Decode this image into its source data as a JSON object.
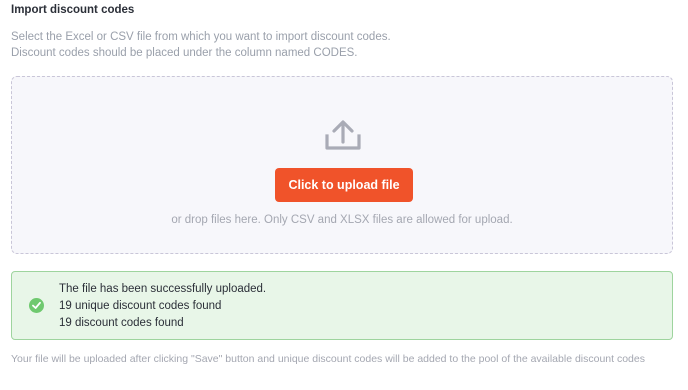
{
  "header": {
    "title": "Import discount codes",
    "description_line1": "Select the Excel or CSV file from which you want to import discount codes.",
    "description_line2": "Discount codes should be placed under the column named CODES."
  },
  "dropzone": {
    "icon": "upload-icon",
    "button_label": "Click to upload file",
    "hint": "or drop files here. Only CSV and XLSX files are allowed for upload."
  },
  "status": {
    "icon": "check-circle-icon",
    "line1": "The file has been successfully uploaded.",
    "line2": "19 unique discount codes found",
    "line3": "19 discount codes found"
  },
  "footnote": "Your file will be uploaded after clicking \"Save\" button and unique discount codes will be added to the pool of the available discount codes",
  "colors": {
    "accent": "#f0532a",
    "success_bg": "#e8f6e8",
    "success_border": "#9ed49e",
    "success_icon": "#6fc96f"
  }
}
